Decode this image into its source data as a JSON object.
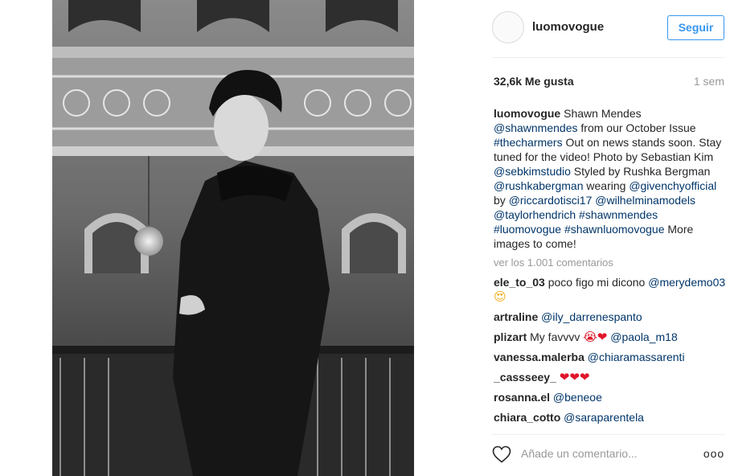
{
  "post": {
    "username": "luomovogue",
    "follow_label": "Seguir",
    "likes": "32,6k Me gusta",
    "time": "1 sem"
  },
  "caption": {
    "user": "luomovogue",
    "t1": " Shawn Mendes ",
    "m1": "@shawnmendes",
    "t2": " from our October Issue ",
    "h1": "#thecharmers",
    "t3": " Out on news stands soon. Stay tuned for the video! Photo by Sebastian Kim ",
    "m2": "@sebkimstudio",
    "t4": " Styled by Rushka Bergman ",
    "m3": "@rushkabergman",
    "t5": " wearing ",
    "m4": "@givenchyofficial",
    "t6": " by ",
    "m5": "@riccardotisci17",
    "t7": " ",
    "m6": "@wilhelminamodels",
    "t8": " ",
    "m7": "@taylorhendrich",
    "t9": " ",
    "h2": "#shawnmendes",
    "t10": " ",
    "h3": "#luomovogue",
    "t11": " ",
    "h4": "#shawnluomovogue",
    "t12": " More images to come!"
  },
  "view_all_comments": "ver los 1.001 comentarios",
  "comments": [
    {
      "user": "ele_to_03",
      "text": " poco figo mi dicono ",
      "mention": "@merydemo03",
      "emoji": " 😍"
    },
    {
      "user": "artraline",
      "text": " ",
      "mention": "@ily_darrenespanto"
    },
    {
      "user": "plizart",
      "text": " My favvvv ",
      "emoji": "😭❤",
      "mention": " @paola_m18"
    },
    {
      "user": "vanessa.malerba",
      "text": " ",
      "mention": "@chiaramassarenti"
    },
    {
      "user": "_cassseey_",
      "text": " ",
      "emoji": "❤❤❤"
    },
    {
      "user": "rosanna.el",
      "text": " ",
      "mention": "@beneoe"
    },
    {
      "user": "chiara_cotto",
      "text": " ",
      "mention": "@saraparentela"
    }
  ],
  "footer": {
    "comment_placeholder": "Añade un comentario...",
    "more_label": "ooo"
  },
  "icons": {
    "like": "heart-outline-icon",
    "more": "more-options-icon"
  },
  "colors": {
    "link": "#003569",
    "accent": "#3897f0",
    "muted": "#999999"
  }
}
